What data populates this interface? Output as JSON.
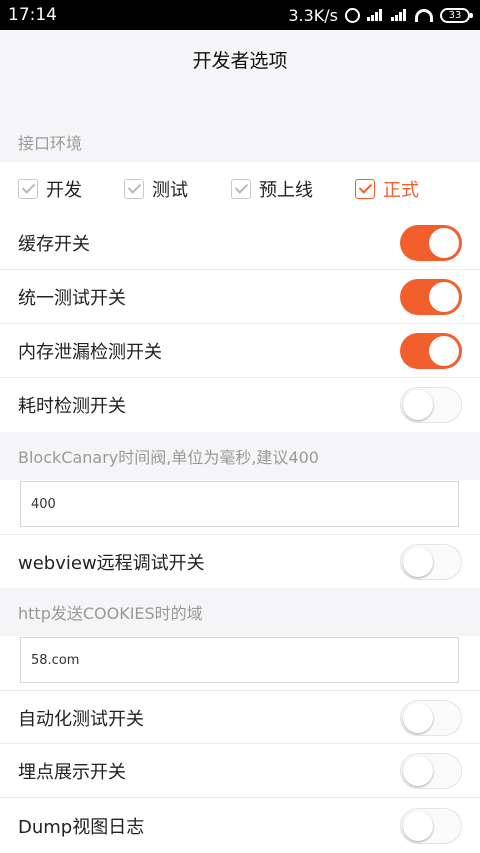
{
  "status_bar": {
    "time": "17:14",
    "speed": "3.3K/s",
    "battery": "33"
  },
  "title": "开发者选项",
  "accent_color": "#f25f2d",
  "interface_env": {
    "header": "接口环境",
    "options": [
      {
        "label": "开发",
        "checked": true
      },
      {
        "label": "测试",
        "checked": true
      },
      {
        "label": "预上线",
        "checked": true
      },
      {
        "label": "正式",
        "checked": true,
        "selected": true
      }
    ]
  },
  "switches_top": [
    {
      "label": "缓存开关",
      "on": true
    },
    {
      "label": "统一测试开关",
      "on": true
    },
    {
      "label": "内存泄漏检测开关",
      "on": true
    },
    {
      "label": "耗时检测开关",
      "on": false
    }
  ],
  "block_canary": {
    "header": "BlockCanary时间阀,单位为毫秒,建议400",
    "value": "400"
  },
  "webview_switch": {
    "label": "webview远程调试开关",
    "on": false
  },
  "cookies_domain": {
    "header": "http发送COOKIES时的域",
    "value": "58.com"
  },
  "switches_bottom": [
    {
      "label": "自动化测试开关",
      "on": false
    },
    {
      "label": "埋点展示开关",
      "on": false
    },
    {
      "label": "Dump视图日志",
      "on": false
    }
  ]
}
